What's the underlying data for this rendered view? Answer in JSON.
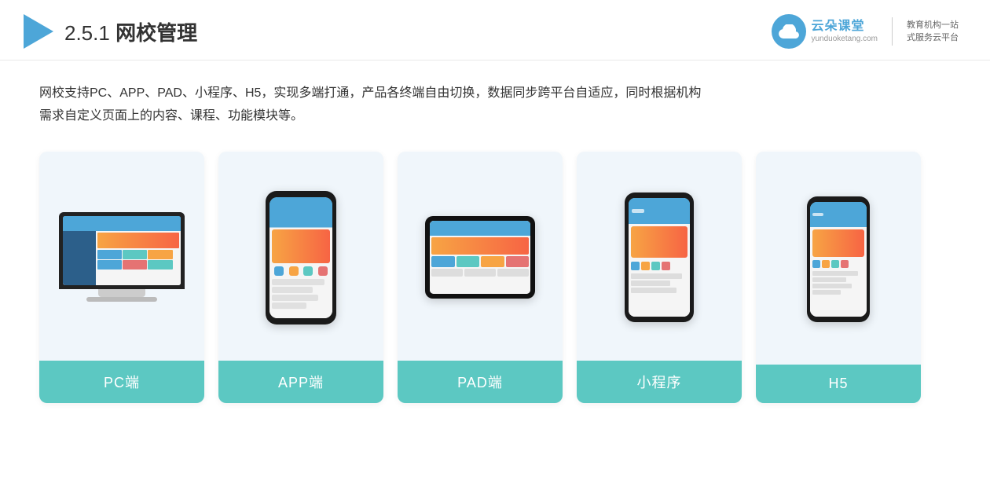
{
  "header": {
    "title_prefix": "2.5.1 ",
    "title_bold": "网校管理",
    "brand": {
      "name": "云朵课堂",
      "url": "yunduoketang.com",
      "slogan_line1": "教育机构一站",
      "slogan_line2": "式服务云平台"
    }
  },
  "description": {
    "line1": "网校支持PC、APP、PAD、小程序、H5，实现多端打通，产品各终端自由切换，数据同步跨平台自适应，同时根据机构",
    "line2": "需求自定义页面上的内容、课程、功能模块等。"
  },
  "cards": [
    {
      "id": "pc",
      "label": "PC端"
    },
    {
      "id": "app",
      "label": "APP端"
    },
    {
      "id": "pad",
      "label": "PAD端"
    },
    {
      "id": "miniprogram",
      "label": "小程序"
    },
    {
      "id": "h5",
      "label": "H5"
    }
  ],
  "colors": {
    "teal": "#5cc8c2",
    "blue": "#4da6d8",
    "card_bg": "#edf4fa"
  }
}
